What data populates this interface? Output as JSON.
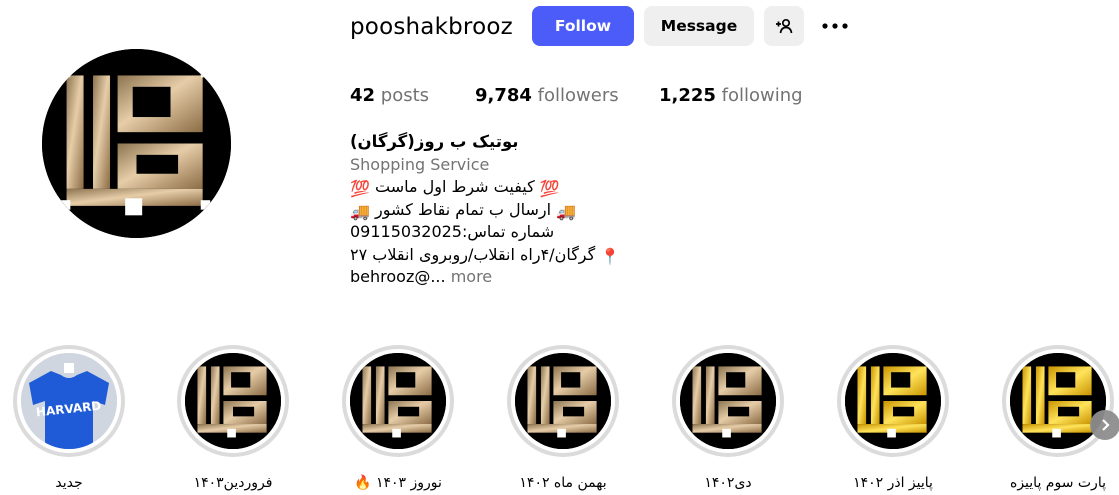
{
  "profile": {
    "username": "pooshakbrooz",
    "follow_label": "Follow",
    "message_label": "Message",
    "add_user_icon": "person-add-icon",
    "more_icon": "more-horizontal-icon"
  },
  "stats": {
    "posts_count": "42",
    "posts_label": "posts",
    "followers_count": "9,784",
    "followers_label": "followers",
    "following_count": "1,225",
    "following_label": "following"
  },
  "bio": {
    "name": "بوتیک ب روز(گرگان)",
    "category": "Shopping Service",
    "line1_text": "کیفیت شرط اول ماست",
    "line1_emoji": "💯",
    "line2_text": "ارسال ب تمام نقاط کشور",
    "line2_emoji": "🚚",
    "line3": "شماره تماس:09115032025",
    "line4_emoji": "📍",
    "line4_text": "گرگان/۴راه انقلاب/روبروی انقلاب ۲۷",
    "line5": "behrooz@...",
    "more_label": "more"
  },
  "highlights": [
    {
      "label": "جدید",
      "style": "photo-blue-shirt"
    },
    {
      "label": "فروردین۱۴۰۳",
      "style": "logo-gold"
    },
    {
      "label": "نوروز ۱۴۰۳ 🔥",
      "style": "logo-gold"
    },
    {
      "label": "بهمن ماه ۱۴۰۲",
      "style": "logo-gold"
    },
    {
      "label": "دی۱۴۰۲",
      "style": "logo-gold"
    },
    {
      "label": "پاییز اذر ۱۴۰۲",
      "style": "logo-yellow"
    },
    {
      "label": "پارت سوم پاییزه",
      "style": "logo-yellow"
    }
  ],
  "colors": {
    "follow_button": "#4c5cf8",
    "secondary_button": "#efefef",
    "muted_text": "#737373",
    "logo_gold": "#b89a73",
    "logo_yellow": "#f2c200"
  },
  "icons": {
    "next": "chevron-right-icon"
  }
}
